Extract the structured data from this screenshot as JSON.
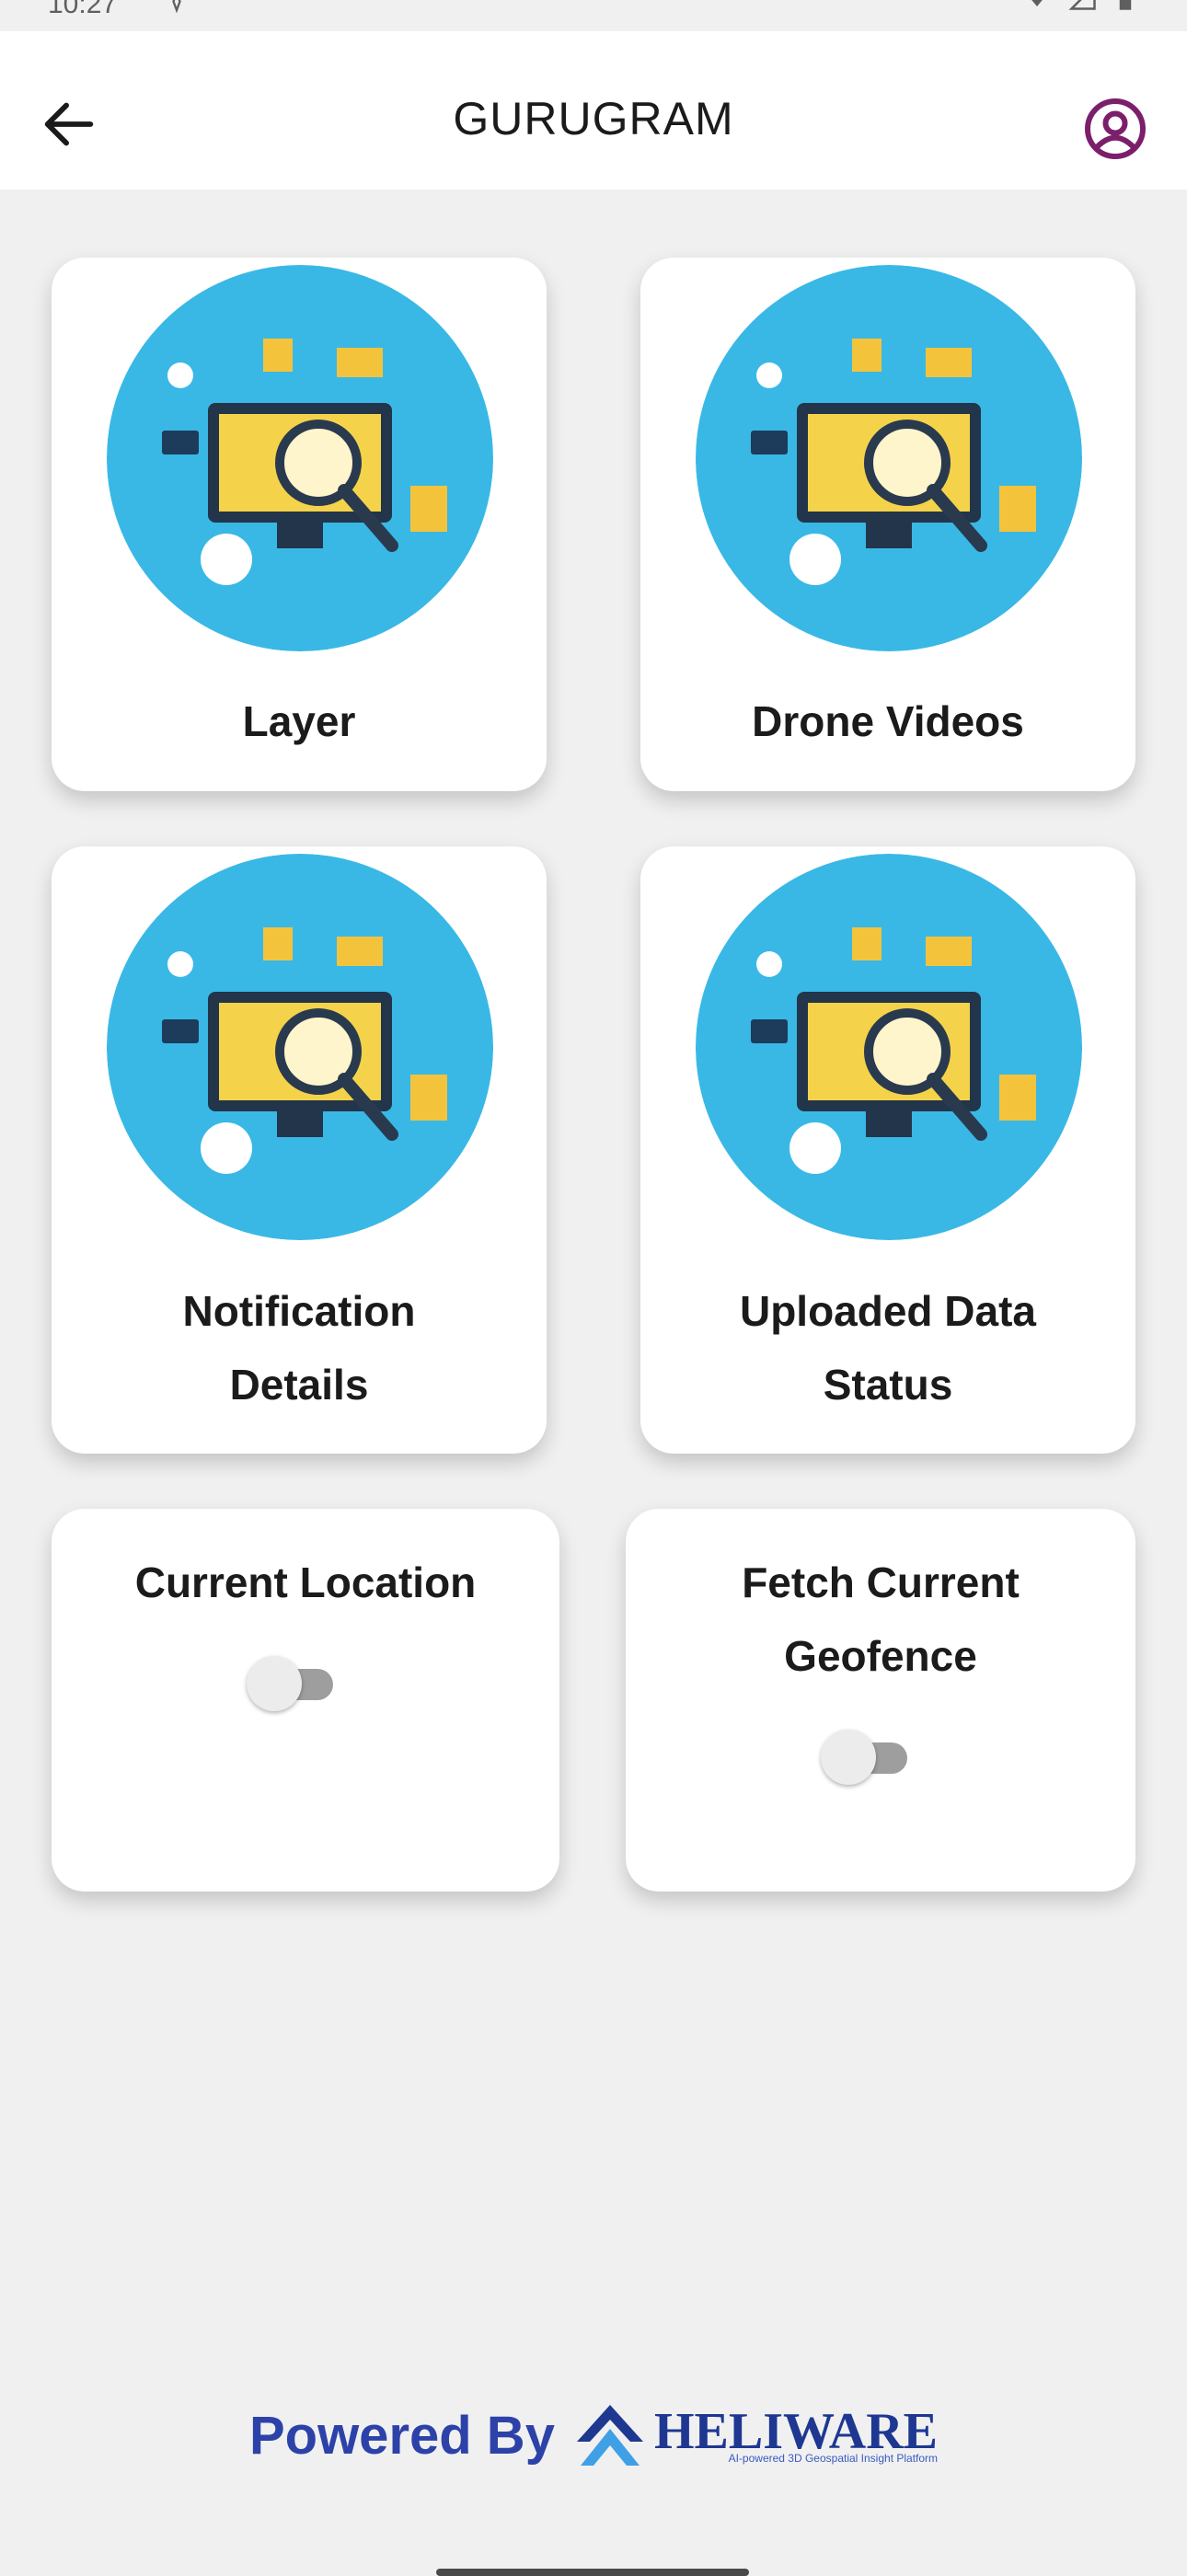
{
  "status_bar": {
    "time": "10:27"
  },
  "app_bar": {
    "title": "GURUGRAM"
  },
  "tiles": [
    {
      "label": "Layer"
    },
    {
      "label": "Drone Videos"
    },
    {
      "label": "Notification Details"
    },
    {
      "label": "Uploaded Data Status"
    }
  ],
  "toggles": [
    {
      "label": "Current Location",
      "on": false
    },
    {
      "label": "Fetch Current Geofence",
      "on": false
    }
  ],
  "footer": {
    "powered_by": "Powered By",
    "brand": "HELIWARE",
    "tagline": "AI-powered 3D Geospatial Insight Platform"
  },
  "icons": {
    "back": "arrow-left-icon",
    "profile": "user-circle-icon",
    "tile_thumb": "ecommerce-illustration"
  },
  "colors": {
    "accent": "#7b1f6b",
    "brand": "#1e3791",
    "illustration_bg": "#39b8e6"
  }
}
